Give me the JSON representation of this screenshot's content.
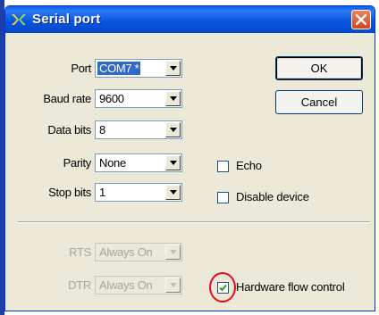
{
  "window": {
    "title": "Serial port",
    "icon": "serial-port-app-icon",
    "close_icon": "close-icon"
  },
  "fields": {
    "port": {
      "label": "Port",
      "value": "COM7 *"
    },
    "baud_rate": {
      "label": "Baud rate",
      "value": "9600"
    },
    "data_bits": {
      "label": "Data bits",
      "value": "8"
    },
    "parity": {
      "label": "Parity",
      "value": "None"
    },
    "stop_bits": {
      "label": "Stop bits",
      "value": "1"
    },
    "rts": {
      "label": "RTS",
      "value": "Always On"
    },
    "dtr": {
      "label": "DTR",
      "value": "Always On"
    }
  },
  "buttons": {
    "ok": "OK",
    "cancel": "Cancel"
  },
  "checkboxes": {
    "echo": {
      "label": "Echo",
      "checked": false
    },
    "disable_device": {
      "label": "Disable device",
      "checked": false
    },
    "hardware_flow_control": {
      "label": "Hardware flow control",
      "checked": true
    }
  },
  "colors": {
    "title_bar": "#0a56df",
    "dialog_bg": "#ece9d8",
    "selection": "#316ac5",
    "highlight_circle": "#e8091c"
  }
}
